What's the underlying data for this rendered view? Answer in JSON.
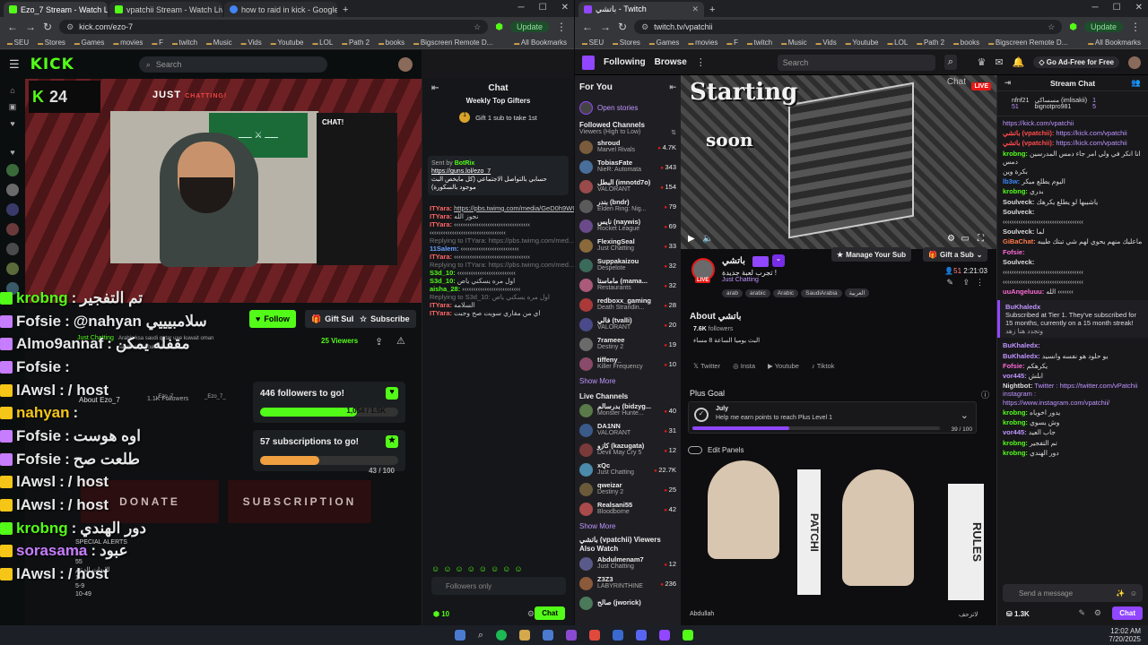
{
  "left_browser": {
    "tabs": [
      {
        "title": "Ezo_7 Stream - Watch Live on",
        "color": "#53fc18",
        "active": true
      },
      {
        "title": "vpatchii Stream - Watch Live on",
        "color": "#53fc18"
      },
      {
        "title": "how to raid in kick - Google Search",
        "color": "#4285f4"
      }
    ],
    "url": "kick.com/ezo-7",
    "update_label": "Update",
    "bookmarks": [
      "SEU",
      "Stores",
      "Games",
      "movies",
      "F",
      "twitch",
      "Music",
      "Vids",
      "Youtube",
      "LOL",
      "Path 2",
      "books",
      "Bigscreen Remote D...",
      "All Bookmarks"
    ]
  },
  "right_browser": {
    "tabs": [
      {
        "title": "باتشي - Twitch",
        "color": "#9146ff",
        "active": true
      }
    ],
    "url": "twitch.tv/vpatchii",
    "update_label": "Update",
    "bookmarks": [
      "SEU",
      "Stores",
      "Games",
      "movies",
      "F",
      "twitch",
      "Music",
      "Vids",
      "Youtube",
      "LOL",
      "Path 2",
      "books",
      "Bigscreen Remote D...",
      "All Bookmarks"
    ]
  },
  "kick": {
    "logo": "KICK",
    "search_placeholder": "Search",
    "video": {
      "number": "24",
      "just": "JUST",
      "chatting": "CHATTING!",
      "chat": "CHAT!"
    },
    "overlay_chat": [
      {
        "user": "krobng",
        "msg": "تم التفجير",
        "color": "#53fc18"
      },
      {
        "user": "Fofsie",
        "msg": "@nahyan سلامبيييي",
        "color": "#c77dff"
      },
      {
        "user": "Almo9annaf",
        "msg": "مقفله يمكن",
        "color": "#c77dff"
      },
      {
        "user": "Fofsie",
        "msg": "",
        "color": "#c77dff"
      },
      {
        "user": "lAwsl",
        "msg": "/ host",
        "color": "#f5c518"
      },
      {
        "user": "nahyan",
        "msg": "",
        "color": "#f5c518"
      },
      {
        "user": "Fofsie",
        "msg": "اوه هوست",
        "color": "#c77dff"
      },
      {
        "user": "Fofsie",
        "msg": "طلعت صح",
        "color": "#c77dff"
      },
      {
        "user": "lAwsl",
        "msg": "/ host",
        "color": "#f5c518"
      },
      {
        "user": "lAwsl",
        "msg": "/ host",
        "color": "#f5c518"
      },
      {
        "user": "krobng",
        "msg": "دور الهندي",
        "color": "#53fc18"
      },
      {
        "user": "sorasama",
        "msg": "عبود",
        "color": "#c77dff"
      },
      {
        "user": "lAwsl",
        "msg": "/ host",
        "color": "#f5c518"
      }
    ],
    "follow_label": "Follow",
    "gift_label": "Gift Subs",
    "subscribe_label": "Subscribe",
    "viewers": "25 Viewers",
    "about": "About Ezo_7",
    "followers_count": "1.1K Followers",
    "tags": [
      "Arabic",
      "ksa",
      "saudi",
      "qatar",
      "uae",
      "kuwait",
      "oman",
      "saudiarabia",
      "bahrain"
    ],
    "category": "Just Chatting",
    "socials": [
      "_Ezo_7",
      "_Ezo_7_"
    ],
    "goal1": {
      "title": "446 followers to go!",
      "progress": "1,054 / 1.5K",
      "fraction": 0.7
    },
    "goal2": {
      "title": "57 subscriptions to go!",
      "progress": "43 / 100",
      "fraction": 0.43
    },
    "panels": [
      "DONATE",
      "SUBSCRIPTION"
    ],
    "special_alerts": "SPECIAL ALERTS",
    "alerts_list": [
      "35",
      "55",
      "الإيدات الدعم",
      "1-4",
      "5-9",
      "10-49"
    ],
    "chat": {
      "title": "Chat",
      "weekly_title": "Weekly Top Gifters",
      "gift_prompt": "Gift 1 sub to take 1st",
      "sent_by": "Sent by",
      "bot": "BotRix",
      "pinned_link": "https://guns.lol/ezo_7",
      "pinned_msg": "حسابي بالتواصل الاجتماعي (كل مايخص البث موجود بالسكورة)",
      "lines": [
        {
          "user": "ITYara:",
          "text": "https://pbs.twimg.com/media/GeD0h9WUAcd8W0.jpg"
        },
        {
          "user": "ITYara:",
          "text": "نجوز الله"
        },
        {
          "user": "ITYara:",
          "text": "‹‹‹‹‹‹‹‹‹‹‹‹‹‹‹‹‹‹‹‹‹‹‹‹‹‹‹‹‹‹‹‹‹‹"
        },
        {
          "user": "",
          "text": "‹‹‹‹‹‹‹‹‹‹‹‹‹‹‹‹‹‹‹‹‹‹‹‹‹‹‹‹‹‹‹‹‹‹"
        },
        {
          "user": "",
          "text": "Replying to ITYara: https://pbs.twimg.com/med..."
        },
        {
          "user": "11Salem:",
          "text": "‹‹‹‹‹‹‹‹‹‹‹‹‹‹‹‹‹‹‹‹‹‹‹‹‹‹"
        },
        {
          "user": "ITYara:",
          "text": "‹‹‹‹‹‹‹‹‹‹‹‹‹‹‹‹‹‹‹‹‹‹‹‹‹‹‹‹‹‹‹‹‹‹"
        },
        {
          "user": "",
          "text": "Replying to ITYara: https://pbs.twimg.com/med..."
        },
        {
          "user": "S3d_10:",
          "text": "‹‹‹‹‹‹‹‹‹‹‹‹‹‹‹‹‹‹‹‹‹‹‹‹‹‹"
        },
        {
          "user": "S3d_10:",
          "text": "اول مره يسكني ياص"
        },
        {
          "user": "aisha_28:",
          "text": "‹‹‹‹‹‹‹‹‹‹‹‹‹‹‹‹‹‹‹‹‹‹‹‹‹‹"
        },
        {
          "user": "",
          "text": "Replying to S3d_10: اول مره يسكني ياص"
        },
        {
          "user": "ITYara:",
          "text": "السلامه"
        },
        {
          "user": "ITYara:",
          "text": "اي من مقاري سويت صح وجبت"
        }
      ],
      "input_placeholder": "Followers only",
      "points": "10",
      "send_label": "Chat"
    }
  },
  "twitch": {
    "nav": [
      "Following",
      "Browse"
    ],
    "search_placeholder": "Search",
    "ad_free": "Go Ad-Free for Free",
    "for_you": "For You",
    "open_stories": "Open stories",
    "followed_title": "Followed Channels",
    "followed_sub": "Viewers (High to Low)",
    "followed": [
      {
        "name": "shroud",
        "game": "Marvel Rivals",
        "viewers": "4.7K",
        "color": "#7a5c3c"
      },
      {
        "name": "TobiasFate",
        "game": "NieR: Automata",
        "viewers": "343",
        "color": "#4a6e9a"
      },
      {
        "name": "البطل (imnotd7o)",
        "game": "VALORANT",
        "viewers": "154",
        "color": "#9a4a4a"
      },
      {
        "name": "بندر (bndr)",
        "game": "Elden Ring: Nig...",
        "viewers": "79",
        "color": "#5a5a5a"
      },
      {
        "name": "نايس (naywis)",
        "game": "Rocket League",
        "viewers": "69",
        "color": "#6a4a8a"
      },
      {
        "name": "FlexingSeal",
        "game": "Just Chatting",
        "viewers": "33",
        "color": "#8a6a3a"
      },
      {
        "name": "Suppakaizou",
        "game": "Despelote",
        "viewers": "32",
        "color": "#3a6a5a"
      },
      {
        "name": "ماماستا (mama...",
        "game": "Restaurants",
        "viewers": "32",
        "color": "#aa5a7a"
      },
      {
        "name": "redboxx_gaming",
        "game": "Death Strandin...",
        "viewers": "28",
        "color": "#aa3a3a"
      },
      {
        "name": "فالي (tvalli)",
        "game": "VALORANT",
        "viewers": "20",
        "color": "#4a4a8a"
      },
      {
        "name": "7rameee",
        "game": "Destiny 2",
        "viewers": "19",
        "color": "#6a6a6a"
      },
      {
        "name": "tiffeny_",
        "game": "Killer Frequency",
        "viewers": "10",
        "color": "#8a4a6a"
      }
    ],
    "show_more": "Show More",
    "live_title": "Live Channels",
    "live": [
      {
        "name": "بدرسالم (bidzyg...",
        "game": "Monster Hunte...",
        "viewers": "40",
        "color": "#5a7a4a"
      },
      {
        "name": "DA1NN",
        "game": "VALORANT",
        "viewers": "31",
        "color": "#3a5a8a"
      },
      {
        "name": "كازو (kazugata)",
        "game": "Devil May Cry 5",
        "viewers": "12",
        "color": "#7a3a3a"
      },
      {
        "name": "xQc",
        "game": "Just Chatting",
        "viewers": "22.7K",
        "color": "#4a8aaa"
      },
      {
        "name": "qweizar",
        "game": "Destiny 2",
        "viewers": "25",
        "color": "#6a5a3a"
      },
      {
        "name": "Realsani55",
        "game": "Bloodborne",
        "viewers": "42",
        "color": "#aa4a4a"
      }
    ],
    "also_watch": "باتشي (vpatchii) Viewers Also Watch",
    "also": [
      {
        "name": "Abdulmenam7",
        "game": "Just Chatting",
        "viewers": "12",
        "color": "#5a5a8a"
      },
      {
        "name": "Z3Z3",
        "game": "LABYRINTHINE",
        "viewers": "236",
        "color": "#8a5a3a"
      },
      {
        "name": "صالح (jworick)",
        "game": "",
        "viewers": "",
        "color": "#4a7a5a"
      }
    ],
    "video": {
      "starting": "Starting",
      "soon": "soon",
      "chat": "Chat",
      "live": "LIVE"
    },
    "channel": {
      "name": "باتشي",
      "title": "تجرب لعبة جديدة !",
      "category": "Just Chatting",
      "tags": [
        "arab",
        "arabic",
        "Arabic",
        "SaudiArabia",
        "العربية"
      ],
      "manage_sub": "Manage Your Sub",
      "gift_sub": "Gift a Sub",
      "viewers": "51",
      "uptime": "2:21:03",
      "live_badge": "LIVE"
    },
    "about": {
      "title": "About باتشي",
      "followers": "7.6K",
      "followers_label": "followers",
      "desc": "البث يوميا الساعة 8 مساء",
      "socials": [
        "Twitter",
        "Insta",
        "Youtube",
        "Tiktok"
      ]
    },
    "plus_goal": {
      "title": "Plus Goal",
      "month": "July",
      "desc": "Help me earn points to reach Plus Level 1",
      "progress": "39 / 100",
      "fraction": 0.39
    },
    "edit_panels": "Edit Panels",
    "panel_art": {
      "patchi": "PATCHI",
      "rules": "RULES",
      "credit": "Abdullah",
      "credit2": "لاتزحف"
    },
    "chat": {
      "title": "Stream Chat",
      "top_gifters": [
        {
          "name": "nfnf21",
          "count": "51"
        },
        {
          "name": "مسساكي (imlisakii)",
          "count": "1"
        },
        {
          "name": "bignotpro981",
          "count": "5"
        }
      ],
      "lines": [
        {
          "u": "",
          "t": "https://kick.com/vpatchii",
          "c": "#bf94ff",
          "link": true
        },
        {
          "u": "باتشي (vpatchii):",
          "t": "https://kick.com/vpatchii",
          "c": "#ff4a4a",
          "link": true
        },
        {
          "u": "باتشي (vpatchii):",
          "t": "https://kick.com/vpatchii",
          "c": "#ff4a4a",
          "link": true
        },
        {
          "u": "krobng:",
          "t": "انا انكر في ولي امر جاء دمس المدرسين دمس",
          "c": "#53fc18"
        },
        {
          "u": "",
          "t": "بكرة وين",
          "c": "#aaa"
        },
        {
          "u": "lb3w:",
          "t": "اليوم يطلع ميكر",
          "c": "#3a8aff"
        },
        {
          "u": "krobng:",
          "t": "بدري",
          "c": "#53fc18"
        },
        {
          "u": "Soulveck:",
          "t": "ياشيبها لو يطلع يكرهك",
          "c": "#ddd"
        },
        {
          "u": "Soulveck:",
          "t": "",
          "c": "#ddd"
        },
        {
          "u": "",
          "t": "‹‹‹‹‹‹‹‹‹‹‹‹‹‹‹‹‹‹‹‹‹‹‹‹‹‹‹‹‹‹‹‹‹‹‹‹",
          "c": "#aaa"
        },
        {
          "u": "Soulveck:",
          "t": "لما",
          "c": "#ddd"
        },
        {
          "u": "GiBaChat:",
          "t": "ماعليك منهم يحوي لهم شي تبتك طيبه",
          "c": "#ff7a4a"
        },
        {
          "u": "Fofsie:",
          "t": "",
          "c": "#ff6ad5"
        },
        {
          "u": "Soulveck:",
          "t": "",
          "c": "#ddd"
        },
        {
          "u": "",
          "t": "‹‹‹‹‹‹‹‹‹‹‹‹‹‹‹‹‹‹‹‹‹‹‹‹‹‹‹‹‹‹‹‹‹‹‹‹",
          "c": "#aaa"
        },
        {
          "u": "",
          "t": "‹‹‹‹‹‹‹‹‹‹‹‹‹‹‹‹‹‹‹‹‹‹‹‹‹‹‹‹‹‹‹‹‹‹‹‹",
          "c": "#aaa"
        },
        {
          "u": "uuAngeluuu:",
          "t": "الله ‹‹‹‹‹‹‹",
          "c": "#ff6ad5"
        }
      ],
      "sub_user": "BuKhaledx",
      "sub_text": "Subscribed at Tier 1. They've subscribed for 15 months, currently on a 15 month streak!",
      "sub_msg": "وتجدد هنا زهد",
      "lines2": [
        {
          "u": "BuKhaledx:",
          "t": "",
          "c": "#bf94ff"
        },
        {
          "u": "BuKhaledx:",
          "t": "يو حلود هو نفسه وانسيد",
          "c": "#bf94ff"
        },
        {
          "u": "Fofsie:",
          "t": "يكرهكم",
          "c": "#ff6ad5"
        },
        {
          "u": "vor445:",
          "t": "ابلش",
          "c": "#bf94ff"
        },
        {
          "u": "Nightbot:",
          "t": "Twitter : https://twitter.com/vPatchii instagram : https://www.instagram.com/vpatchii/",
          "c": "#ddd",
          "link": true
        },
        {
          "u": "krobng:",
          "t": "يدور اخوياه",
          "c": "#53fc18"
        },
        {
          "u": "krobng:",
          "t": "وش يسوي",
          "c": "#53fc18"
        },
        {
          "u": "vor445:",
          "t": "جاب العيد",
          "c": "#bf94ff"
        },
        {
          "u": "krobng:",
          "t": "تم التفجير",
          "c": "#53fc18"
        },
        {
          "u": "krobng:",
          "t": "دور الهندي",
          "c": "#53fc18"
        }
      ],
      "input_placeholder": "Send a message",
      "points": "1.3K",
      "send_label": "Chat"
    }
  },
  "taskbar": {
    "time": "12:02 AM",
    "date": "7/20/2025"
  }
}
